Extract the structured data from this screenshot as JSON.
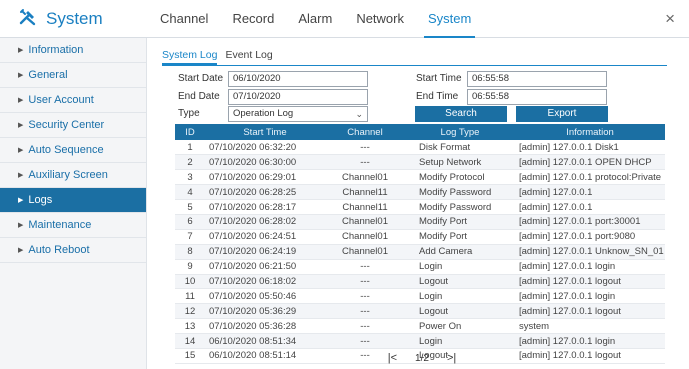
{
  "app": {
    "title": "System",
    "close_symbol": "×"
  },
  "top_nav": [
    {
      "label": "Channel",
      "active": false
    },
    {
      "label": "Record",
      "active": false
    },
    {
      "label": "Alarm",
      "active": false
    },
    {
      "label": "Network",
      "active": false
    },
    {
      "label": "System",
      "active": true
    }
  ],
  "sidebar": {
    "items": [
      {
        "label": "Information",
        "active": false
      },
      {
        "label": "General",
        "active": false
      },
      {
        "label": "User Account",
        "active": false
      },
      {
        "label": "Security Center",
        "active": false
      },
      {
        "label": "Auto Sequence",
        "active": false
      },
      {
        "label": "Auxiliary Screen",
        "active": false
      },
      {
        "label": "Logs",
        "active": true
      },
      {
        "label": "Maintenance",
        "active": false
      },
      {
        "label": "Auto Reboot",
        "active": false
      }
    ]
  },
  "subtabs": [
    {
      "label": "System Log",
      "active": true
    },
    {
      "label": "Event Log",
      "active": false
    }
  ],
  "filters": {
    "start_date_label": "Start Date",
    "start_date": "06/10/2020",
    "end_date_label": "End Date",
    "end_date": "07/10/2020",
    "type_label": "Type",
    "type_value": "Operation Log",
    "start_time_label": "Start Time",
    "start_time": "06:55:58",
    "end_time_label": "End Time",
    "end_time": "06:55:58",
    "search_label": "Search",
    "export_label": "Export"
  },
  "table": {
    "columns": [
      "ID",
      "Start Time",
      "Channel",
      "Log Type",
      "Information"
    ],
    "rows": [
      [
        "1",
        "07/10/2020 06:32:20",
        "---",
        "Disk Format",
        "[admin] 127.0.0.1 Disk1"
      ],
      [
        "2",
        "07/10/2020 06:30:00",
        "---",
        "Setup Network",
        "[admin] 127.0.0.1 OPEN DHCP"
      ],
      [
        "3",
        "07/10/2020 06:29:01",
        "Channel01",
        "Modify Protocol",
        "[admin] 127.0.0.1 protocol:Private"
      ],
      [
        "4",
        "07/10/2020 06:28:25",
        "Channel11",
        "Modify Password",
        "[admin] 127.0.0.1"
      ],
      [
        "5",
        "07/10/2020 06:28:17",
        "Channel11",
        "Modify Password",
        "[admin] 127.0.0.1"
      ],
      [
        "6",
        "07/10/2020 06:28:02",
        "Channel01",
        "Modify Port",
        "[admin] 127.0.0.1 port:30001"
      ],
      [
        "7",
        "07/10/2020 06:24:51",
        "Channel01",
        "Modify Port",
        "[admin] 127.0.0.1 port:9080"
      ],
      [
        "8",
        "07/10/2020 06:24:19",
        "Channel01",
        "Add Camera",
        "[admin] 127.0.0.1 Unknow_SN_01"
      ],
      [
        "9",
        "07/10/2020 06:21:50",
        "---",
        "Login",
        "[admin] 127.0.0.1 login"
      ],
      [
        "10",
        "07/10/2020 06:18:02",
        "---",
        "Logout",
        "[admin] 127.0.0.1 logout"
      ],
      [
        "11",
        "07/10/2020 05:50:46",
        "---",
        "Login",
        "[admin] 127.0.0.1 login"
      ],
      [
        "12",
        "07/10/2020 05:36:29",
        "---",
        "Logout",
        "[admin] 127.0.0.1 logout"
      ],
      [
        "13",
        "07/10/2020 05:36:28",
        "---",
        "Power On",
        "system"
      ],
      [
        "14",
        "06/10/2020 08:51:34",
        "---",
        "Login",
        "[admin] 127.0.0.1 login"
      ],
      [
        "15",
        "06/10/2020 08:51:14",
        "---",
        "Logout",
        "[admin] 127.0.0.1 logout"
      ]
    ]
  },
  "pager": {
    "first_symbol": "|<",
    "page_text": "1/2",
    "last_symbol": ">|"
  },
  "icons": {
    "brand": "wrench-hammer-icon",
    "close": "close-icon",
    "sidebar_marker": "triangle-right-icon",
    "select": "chevron-down-icon"
  },
  "colors": {
    "accent": "#1a86c8",
    "active_bg": "#1b6fa3",
    "sidebar_bg": "#f4f5f7"
  }
}
